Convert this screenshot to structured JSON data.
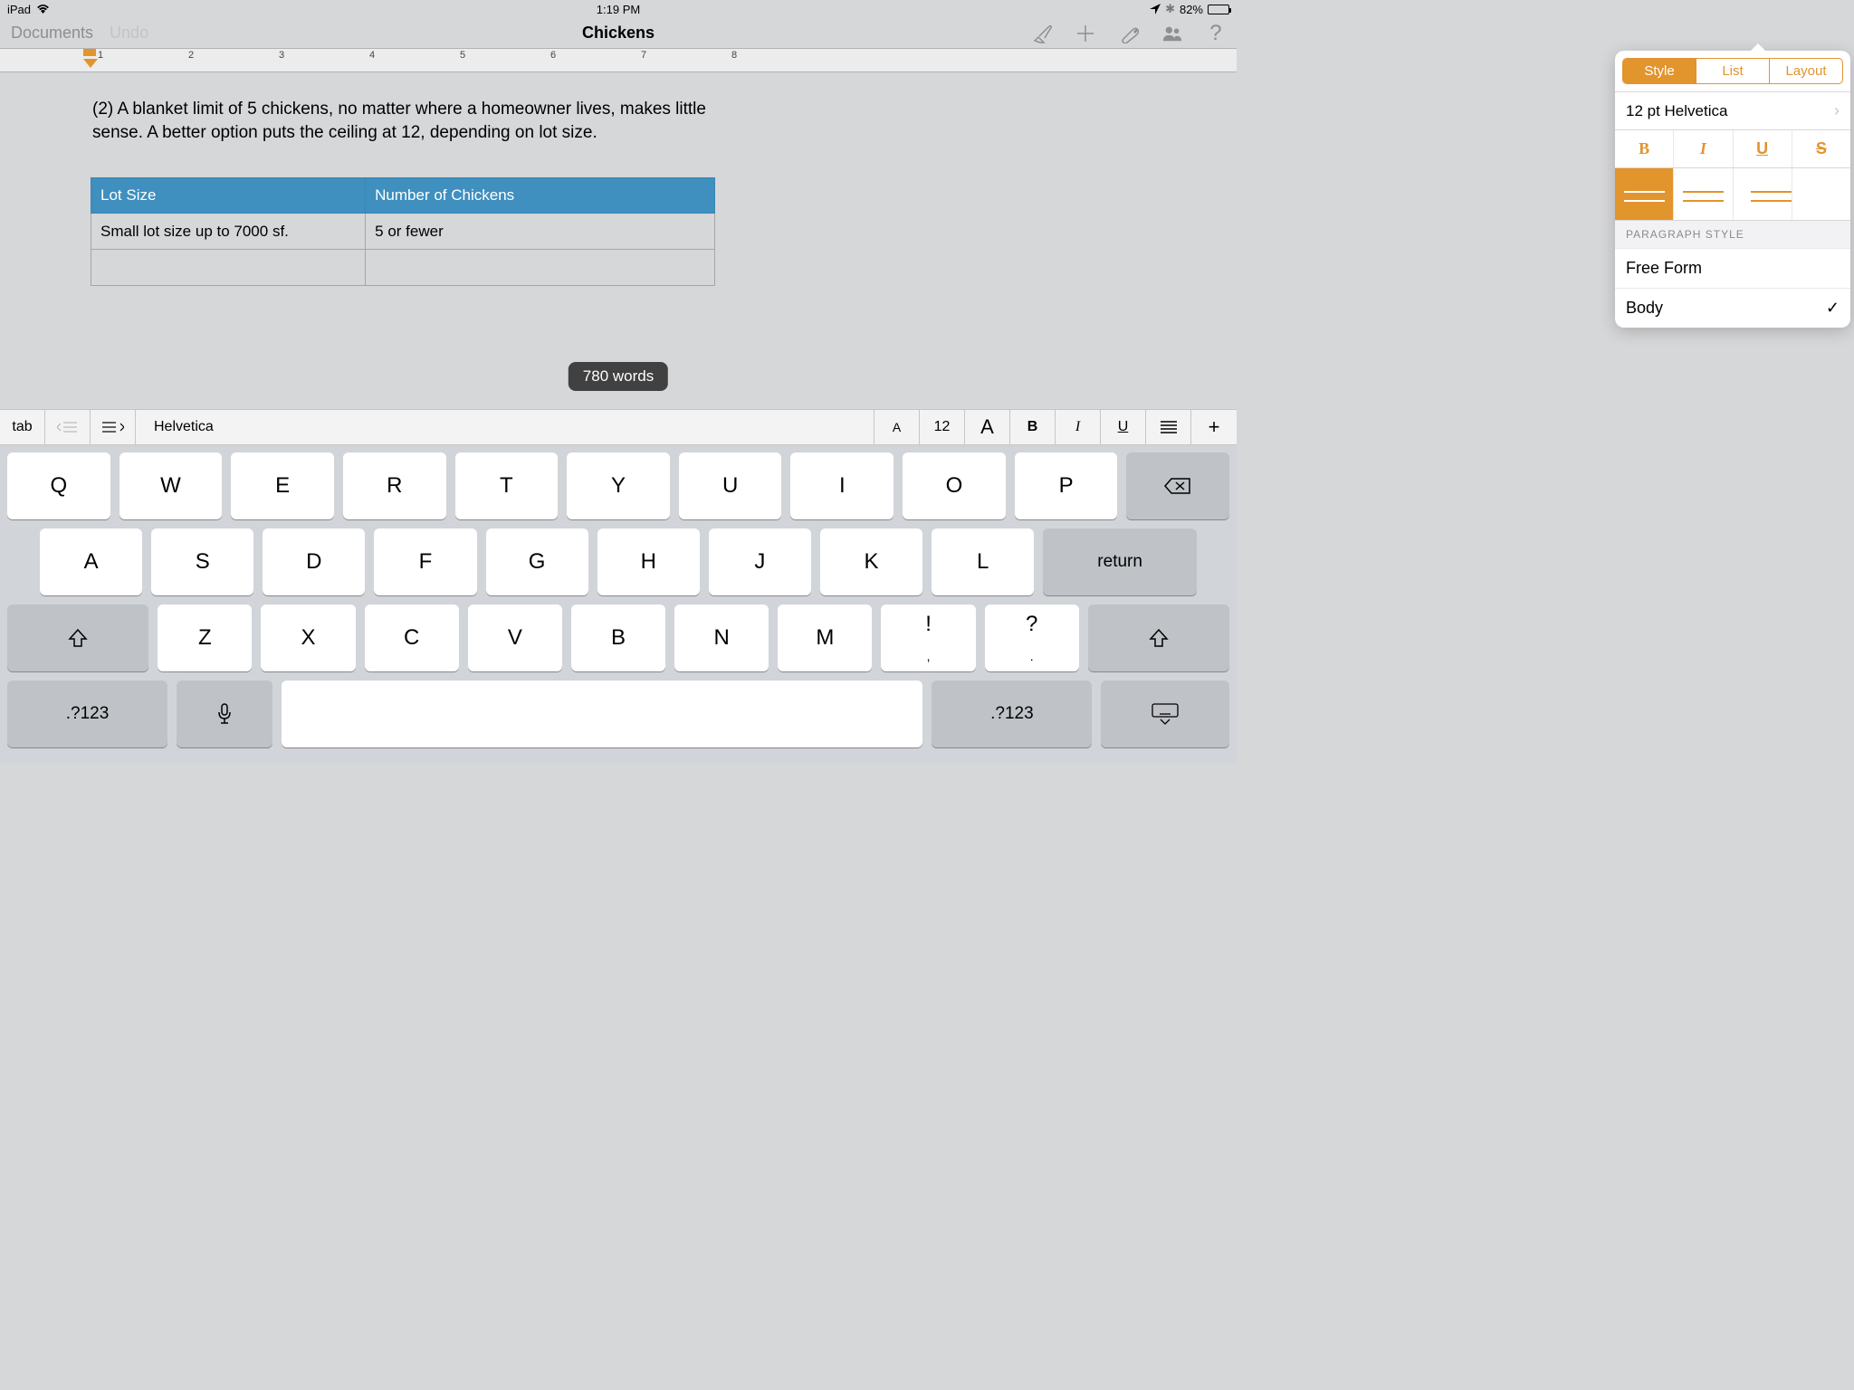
{
  "status": {
    "device": "iPad",
    "time": "1:19 PM",
    "battery_pct": "82%"
  },
  "toolbar": {
    "documents": "Documents",
    "undo": "Undo",
    "title": "Chickens"
  },
  "ruler": {
    "marks": [
      "1",
      "2",
      "3",
      "4",
      "5",
      "6",
      "7",
      "8"
    ]
  },
  "document": {
    "paragraph": "(2) A blanket limit of 5 chickens, no matter where a homeowner lives, makes little sense. A better option puts the ceiling at 12, depending on lot size.",
    "table": {
      "headers": [
        "Lot Size",
        "Number of Chickens"
      ],
      "rows": [
        [
          "Small lot size up to 7000 sf.",
          "5 or fewer"
        ],
        [
          "",
          ""
        ]
      ]
    },
    "word_count": "780 words"
  },
  "format_popover": {
    "tabs": [
      "Style",
      "List",
      "Layout"
    ],
    "font_row": "12 pt Helvetica",
    "text_styles": [
      "B",
      "I",
      "U",
      "S"
    ],
    "section_label": "PARAGRAPH STYLE",
    "paragraph_styles": [
      "Free Form",
      "Body"
    ]
  },
  "kb_toolbar": {
    "tab": "tab",
    "font": "Helvetica",
    "size_small": "A",
    "size_val": "12",
    "size_big": "A",
    "bold": "B",
    "italic": "I",
    "underline": "U",
    "add": "+"
  },
  "keyboard": {
    "row1": [
      "Q",
      "W",
      "E",
      "R",
      "T",
      "Y",
      "U",
      "I",
      "O",
      "P"
    ],
    "row2": [
      "A",
      "S",
      "D",
      "F",
      "G",
      "H",
      "J",
      "K",
      "L"
    ],
    "row3": [
      "Z",
      "X",
      "C",
      "V",
      "B",
      "N",
      "M"
    ],
    "punct1_top": "!",
    "punct1_bot": ",",
    "punct2_top": "?",
    "punct2_bot": ".",
    "return": "return",
    "numkey": ".?123"
  }
}
